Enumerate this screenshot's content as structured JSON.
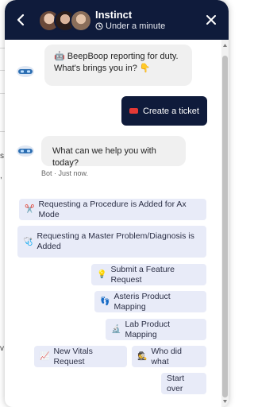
{
  "header": {
    "title": "Instinct",
    "subtitle": "Under a minute",
    "back_icon": "chevron-left-icon",
    "close_icon": "close-icon",
    "background": "#0f1b3b"
  },
  "messages": {
    "bot_greeting_line1": "🤖 BeepBoop reporting for duty.",
    "bot_greeting_line2": "What's brings you in? 👇",
    "user_reply": "Create a ticket",
    "bot_question": "What can we help you with today?",
    "bot_meta": "Bot · Just now."
  },
  "options": [
    {
      "icon": "✂️",
      "label": "Requesting a Procedure is Added for Ax Mode"
    },
    {
      "icon": "🩺",
      "label": "Requesting a Master Problem/Diagnosis is Added"
    },
    {
      "icon": "💡",
      "label": "Submit a Feature Request"
    },
    {
      "icon": "👣",
      "label": "Asteris Product Mapping"
    },
    {
      "icon": "🔬",
      "label": "Lab Product Mapping"
    },
    {
      "icon": "📈",
      "label": "New Vitals Request"
    },
    {
      "icon": "🕵️",
      "label": "Who did what"
    },
    {
      "icon": "",
      "label": "Start over"
    }
  ],
  "colors": {
    "accent": "#0f1b3b",
    "option_bg": "#e8ebf8",
    "bubble_bg": "#f0f0f0"
  }
}
